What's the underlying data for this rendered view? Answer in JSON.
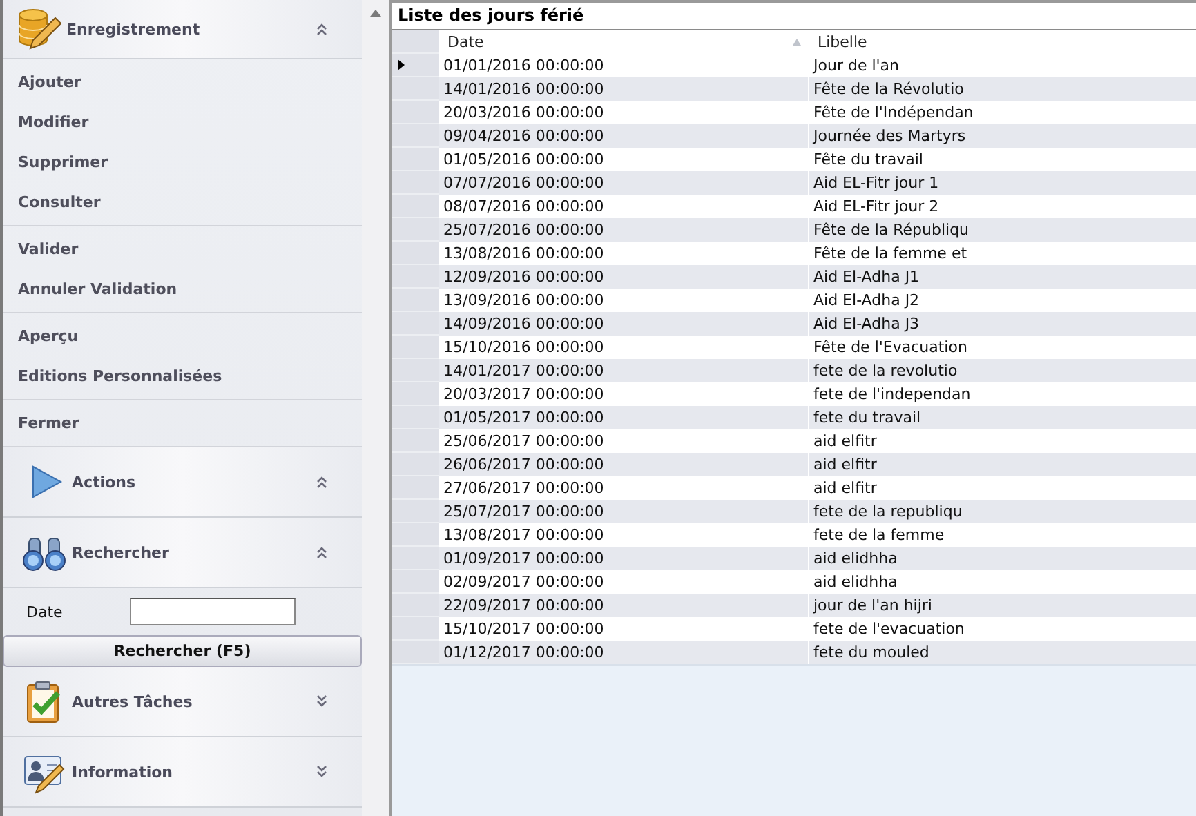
{
  "sidebar": {
    "sections": [
      {
        "title": "Enregistrement",
        "expanded": true,
        "groups": [
          [
            "Ajouter",
            "Modifier",
            "Supprimer",
            "Consulter"
          ],
          [
            "Valider",
            "Annuler Validation"
          ],
          [
            "Aperçu",
            "Editions Personnalisées"
          ],
          [
            "Fermer"
          ]
        ]
      },
      {
        "title": "Actions",
        "expanded": true
      },
      {
        "title": "Rechercher",
        "expanded": true,
        "search": {
          "label": "Date",
          "button": "Rechercher (F5)"
        }
      },
      {
        "title": "Autres Tâches",
        "expanded": false
      },
      {
        "title": "Information",
        "expanded": false
      }
    ]
  },
  "grid": {
    "title": "Liste des jours férié",
    "columns": [
      {
        "label": "Date",
        "sorted": true
      },
      {
        "label": "Libelle",
        "sorted": false
      }
    ],
    "rows": [
      {
        "date": "01/01/2016 00:00:00",
        "libelle": "Jour de l'an",
        "selected": true
      },
      {
        "date": "14/01/2016 00:00:00",
        "libelle": "Fête de la Révolutio",
        "selected": false
      },
      {
        "date": "20/03/2016 00:00:00",
        "libelle": "Fête de l'Indépendan",
        "selected": false
      },
      {
        "date": "09/04/2016 00:00:00",
        "libelle": "Journée des Martyrs",
        "selected": false
      },
      {
        "date": "01/05/2016 00:00:00",
        "libelle": "Fête du travail",
        "selected": false
      },
      {
        "date": "07/07/2016 00:00:00",
        "libelle": "Aid EL-Fitr jour 1",
        "selected": false
      },
      {
        "date": "08/07/2016 00:00:00",
        "libelle": "Aid EL-Fitr jour 2",
        "selected": false
      },
      {
        "date": "25/07/2016 00:00:00",
        "libelle": "Fête de la Républiqu",
        "selected": false
      },
      {
        "date": "13/08/2016 00:00:00",
        "libelle": "Fête de la femme et",
        "selected": false
      },
      {
        "date": "12/09/2016 00:00:00",
        "libelle": "Aid El-Adha J1",
        "selected": false
      },
      {
        "date": "13/09/2016 00:00:00",
        "libelle": "Aid El-Adha J2",
        "selected": false
      },
      {
        "date": "14/09/2016 00:00:00",
        "libelle": "Aid El-Adha J3",
        "selected": false
      },
      {
        "date": "15/10/2016 00:00:00",
        "libelle": "Fête de l'Evacuation",
        "selected": false
      },
      {
        "date": "14/01/2017 00:00:00",
        "libelle": "fete de la revolutio",
        "selected": false
      },
      {
        "date": "20/03/2017 00:00:00",
        "libelle": "fete de l'independan",
        "selected": false
      },
      {
        "date": "01/05/2017 00:00:00",
        "libelle": "fete du travail",
        "selected": false
      },
      {
        "date": "25/06/2017 00:00:00",
        "libelle": "aid elfitr",
        "selected": false
      },
      {
        "date": "26/06/2017 00:00:00",
        "libelle": "aid elfitr",
        "selected": false
      },
      {
        "date": "27/06/2017 00:00:00",
        "libelle": "aid elfitr",
        "selected": false
      },
      {
        "date": "25/07/2017 00:00:00",
        "libelle": "fete de la republiqu",
        "selected": false
      },
      {
        "date": "13/08/2017 00:00:00",
        "libelle": "fete de la femme",
        "selected": false
      },
      {
        "date": "01/09/2017 00:00:00",
        "libelle": "aid elidhha",
        "selected": false
      },
      {
        "date": "02/09/2017 00:00:00",
        "libelle": "aid elidhha",
        "selected": false
      },
      {
        "date": "22/09/2017 00:00:00",
        "libelle": "jour de l'an hijri",
        "selected": false
      },
      {
        "date": "15/10/2017 00:00:00",
        "libelle": "fete de l'evacuation",
        "selected": false
      },
      {
        "date": "01/12/2017 00:00:00",
        "libelle": "fete du mouled",
        "selected": false
      }
    ]
  }
}
